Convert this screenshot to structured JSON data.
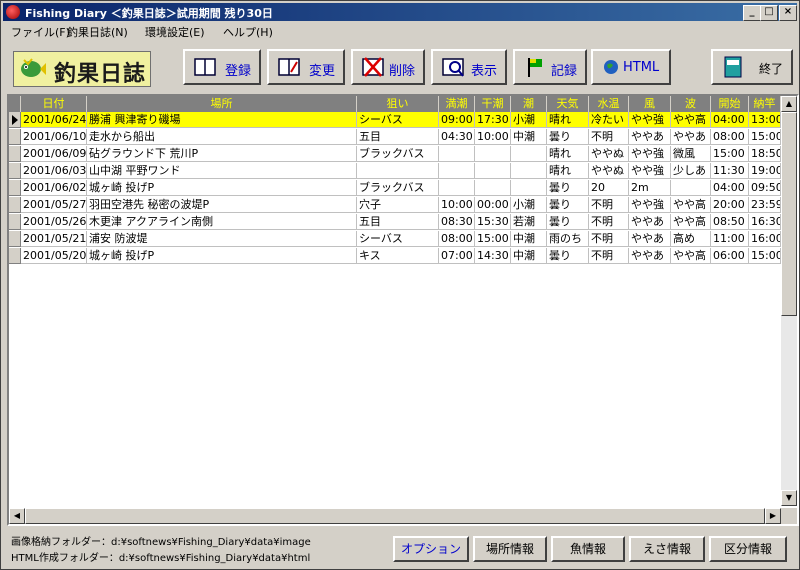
{
  "window": {
    "title": "Fishing Diary ＜釣果日誌＞試用期間 残り30日"
  },
  "menu": [
    "ファイル(F)",
    "釣果日誌(N)",
    "環境設定(E)",
    "ヘルプ(H)"
  ],
  "logo": {
    "text": "釣果日誌"
  },
  "toolbar": {
    "register": "登録",
    "edit": "変更",
    "delete": "削除",
    "view": "表示",
    "record": "記録",
    "html": "HTML",
    "exit": "終了"
  },
  "table": {
    "columns": [
      "日付",
      "場所",
      "狙い",
      "満潮",
      "干潮",
      "潮",
      "天気",
      "水温",
      "風",
      "波",
      "開始",
      "納竿"
    ],
    "rows": [
      [
        "2001/06/24",
        "勝浦 興津寄り磯場",
        "シーバス",
        "09:00",
        "17:30",
        "小潮",
        "晴れ",
        "冷たい",
        "やや強",
        "やや高",
        "04:00",
        "13:00"
      ],
      [
        "2001/06/10",
        "走水から船出",
        "五目",
        "04:30",
        "10:00",
        "中潮",
        "曇り",
        "不明",
        "ややあ",
        "ややあ",
        "08:00",
        "15:00"
      ],
      [
        "2001/06/09",
        "砧グラウンド下 荒川P",
        "ブラックバス",
        "",
        "",
        "",
        "晴れ",
        "ややぬ",
        "やや強",
        "微風",
        "15:00",
        "18:50"
      ],
      [
        "2001/06/03",
        "山中湖 平野ワンド",
        "",
        "",
        "",
        "",
        "晴れ",
        "ややぬ",
        "やや強",
        "少しあ",
        "11:30",
        "19:00"
      ],
      [
        "2001/06/02",
        "城ヶ崎 投げP",
        "ブラックバス",
        "",
        "",
        "",
        "曇り",
        "20",
        "2m",
        "",
        "04:00",
        "09:50"
      ],
      [
        "2001/05/27",
        "羽田空港先 秘密の波堤P",
        "穴子",
        "10:00",
        "00:00",
        "小潮",
        "曇り",
        "不明",
        "やや強",
        "やや高",
        "20:00",
        "23:59"
      ],
      [
        "2001/05/26",
        "木更津 アクアライン南側",
        "五目",
        "08:30",
        "15:30",
        "若潮",
        "曇り",
        "不明",
        "ややあ",
        "やや高",
        "08:50",
        "16:30"
      ],
      [
        "2001/05/21",
        "浦安 防波堤",
        "シーバス",
        "08:00",
        "15:00",
        "中潮",
        "雨のち",
        "不明",
        "ややあ",
        "高め",
        "11:00",
        "16:00"
      ],
      [
        "2001/05/20",
        "城ヶ崎 投げP",
        "キス",
        "07:00",
        "14:30",
        "中潮",
        "曇り",
        "不明",
        "ややあ",
        "やや高",
        "06:00",
        "15:00"
      ]
    ]
  },
  "footer": {
    "image_folder": "画像格納フォルダー：d:¥softnews¥Fishing_Diary¥data¥image",
    "html_folder": "HTML作成フォルダー：d:¥softnews¥Fishing_Diary¥data¥html",
    "buttons": [
      "オプション",
      "場所情報",
      "魚情報",
      "えさ情報",
      "区分情報"
    ]
  }
}
